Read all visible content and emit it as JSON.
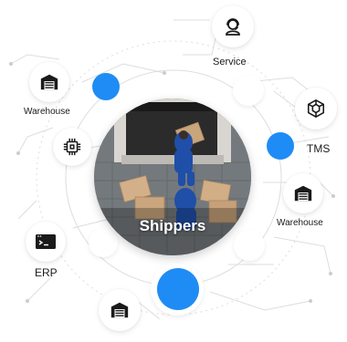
{
  "hub": {
    "title": "Shippers"
  },
  "nodes": {
    "service": {
      "label": "Service",
      "icon": "headset-agent-icon"
    },
    "warehouse_left": {
      "label": "Warehouse",
      "icon": "warehouse-icon"
    },
    "tms": {
      "label": "TMS",
      "icon": "cube-network-icon"
    },
    "chip": {
      "icon": "chip-icon"
    },
    "warehouse_right": {
      "label": "Warehouse",
      "icon": "warehouse-icon"
    },
    "erp": {
      "label": "ERP",
      "icon": "terminal-window-icon"
    },
    "warehouse_bottom": {
      "icon": "warehouse-icon"
    }
  },
  "colors": {
    "accent": "#1f8cf5",
    "lines": "#d8d8d8",
    "icon": "#1a1a1a"
  }
}
